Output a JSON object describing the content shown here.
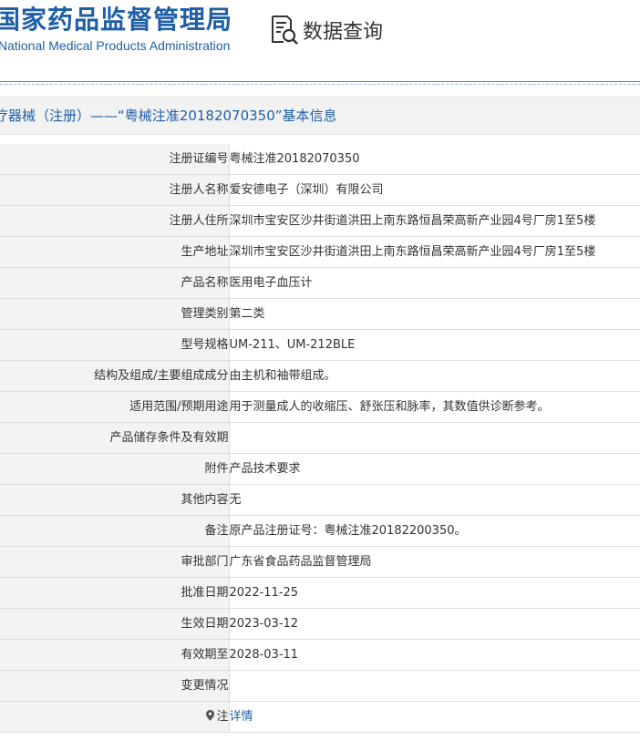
{
  "header": {
    "logo_cn": "国家药品监督管理局",
    "logo_en": "National Medical Products Administration",
    "query_label": "数据查询",
    "query_icon": "document-search-icon"
  },
  "title": "疗器械（注册）——“粤械注准20182070350”基本信息",
  "rows": [
    {
      "label": "注册证编号",
      "value": "粤械注准20182070350"
    },
    {
      "label": "注册人名称",
      "value": "爱安德电子（深圳）有限公司"
    },
    {
      "label": "注册人住所",
      "value": "深圳市宝安区沙井街道洪田上南东路恒昌荣高新产业园4号厂房1至5楼"
    },
    {
      "label": "生产地址",
      "value": "深圳市宝安区沙井街道洪田上南东路恒昌荣高新产业园4号厂房1至5楼"
    },
    {
      "label": "产品名称",
      "value": "医用电子血压计"
    },
    {
      "label": "管理类别",
      "value": "第二类"
    },
    {
      "label": "型号规格",
      "value": "UM-211、UM-212BLE"
    },
    {
      "label": "结构及组成/主要组成成分",
      "value": "由主机和袖带组成。"
    },
    {
      "label": "适用范围/预期用途",
      "value": "用于测量成人的收缩压、舒张压和脉率，其数值供诊断参考。"
    },
    {
      "label": "产品储存条件及有效期",
      "value": ""
    },
    {
      "label": "附件",
      "value": "产品技术要求"
    },
    {
      "label": "其他内容",
      "value": "无"
    },
    {
      "label": "备注",
      "value": "原产品注册证号：粤械注准20182200350。"
    },
    {
      "label": "审批部门",
      "value": "广东省食品药品监督管理局"
    },
    {
      "label": "批准日期",
      "value": "2022-11-25"
    },
    {
      "label": "生效日期",
      "value": "2023-03-12"
    },
    {
      "label": "有效期至",
      "value": "2028-03-11"
    },
    {
      "label": "变更情况",
      "value": ""
    }
  ],
  "note": {
    "icon": "map-pin-icon",
    "label": "注",
    "link_text": "详情"
  },
  "colors": {
    "brand_blue": "#1f5fa6",
    "label_bg": "#f3f3f3",
    "border": "#dddddd"
  }
}
